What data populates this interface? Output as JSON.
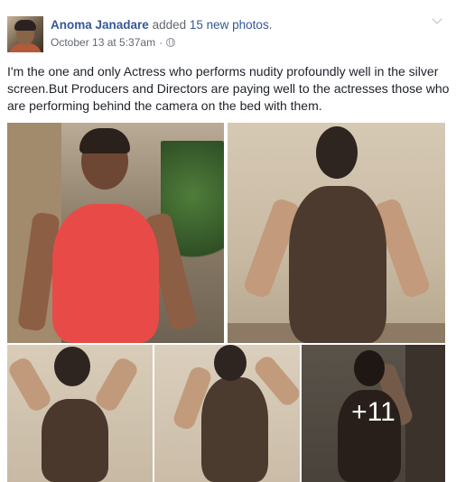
{
  "post": {
    "author": "Anoma Janadare",
    "action_prefix": "added",
    "photos_link": "15 new photos",
    "action_suffix": ".",
    "timestamp": "October 13 at 5:37am",
    "meta_separator": "·",
    "privacy_icon": "globe-icon",
    "text": "I'm the one and only Actress who performs nudity profoundly well in the silver screen.But Producers and Directors are paying well to the actresses those who are performing behind the camera on the bed with them."
  },
  "photos": {
    "more_count": "+11"
  },
  "colors": {
    "link": "#365899",
    "secondary_text": "#616770",
    "primary_text": "#1d2129"
  }
}
